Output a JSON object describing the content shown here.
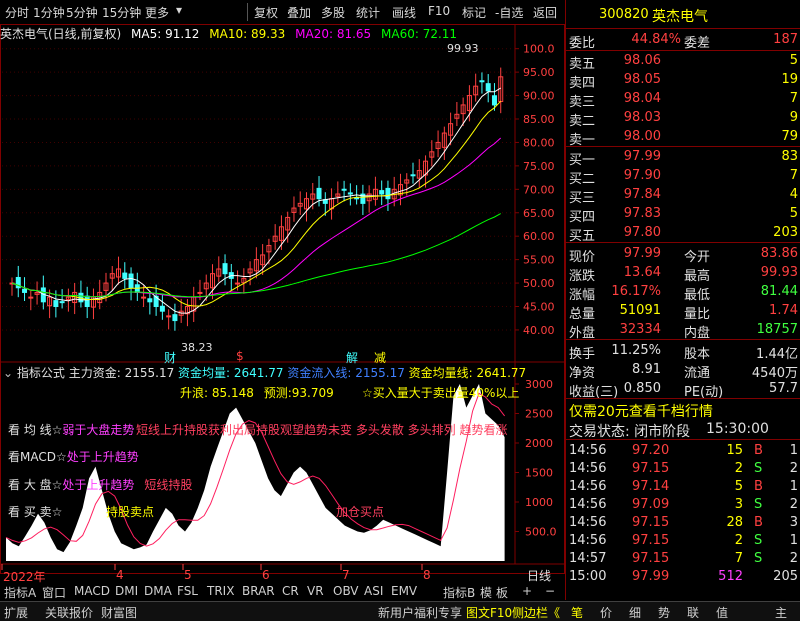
{
  "toolbar": {
    "left_items": [
      "分时",
      "1分钟",
      "5分钟",
      "15分钟",
      "更多"
    ],
    "right_items": [
      "复权",
      "叠加",
      "多股",
      "统计",
      "画线",
      "F10",
      "标记",
      "-自选",
      "返回"
    ]
  },
  "title_bar": {
    "name": "英杰电气(日线,前复权)",
    "ma5": "MA5: 91.12",
    "ma10": "MA10: 89.33",
    "ma20": "MA20: 81.65",
    "ma60": "MA60: 72.11"
  },
  "colors": {
    "ma5": "#ffffff",
    "ma10": "#ffff00",
    "ma20": "#ff00ff",
    "ma60": "#00ff00",
    "up": "#ff4040",
    "down": "#40ffff",
    "frame": "#800000"
  },
  "chart_data": [
    {
      "type": "candlestick",
      "title": "英杰电气(日线,前复权)",
      "ylim": [
        37,
        101
      ],
      "y_ticks": [
        "100.0",
        "95.00",
        "90.00",
        "85.00",
        "80.00",
        "75.00",
        "70.00",
        "65.00",
        "60.00",
        "55.00",
        "50.00",
        "45.00",
        "40.00"
      ],
      "annotations": {
        "high": "99.93",
        "low": "38.23"
      },
      "signals": [
        "财",
        "$",
        "解",
        "减"
      ],
      "close": [
        50,
        49,
        48,
        47,
        48,
        46,
        47,
        45,
        46,
        47,
        48,
        46,
        45,
        47,
        48,
        50,
        52,
        53,
        51,
        49,
        48,
        47,
        46,
        45,
        44,
        43,
        42,
        44,
        45,
        47,
        48,
        50,
        52,
        53,
        52,
        51,
        50,
        51,
        53,
        55,
        56,
        58,
        60,
        62,
        64,
        66,
        67,
        68,
        69,
        68,
        67,
        68,
        69,
        70,
        69,
        68,
        67,
        69,
        70,
        69,
        68,
        70,
        71,
        72,
        73,
        74,
        76,
        78,
        80,
        82,
        84,
        86,
        88,
        90,
        92,
        93,
        91,
        88,
        94
      ]
    },
    {
      "type": "area",
      "title": "指标公式 主力资金",
      "ylim": [
        0,
        3000
      ],
      "y_ticks": [
        "3000",
        "2500",
        "2000",
        "1500",
        "1000",
        "500.0"
      ],
      "values": [
        400,
        300,
        250,
        420,
        600,
        800,
        650,
        400,
        200,
        150,
        320,
        600,
        900,
        1400,
        1600,
        1200,
        800,
        500,
        300,
        250,
        200,
        230,
        280,
        500,
        700,
        900,
        800,
        600,
        500,
        650,
        900,
        1200,
        1600,
        1900,
        2200,
        2500,
        2600,
        2400,
        2200,
        2000,
        1700,
        1400,
        1200,
        1100,
        1300,
        1500,
        1600,
        1500,
        1300,
        1100,
        900,
        800,
        700,
        600,
        550,
        500,
        480,
        520,
        600,
        700,
        650,
        600,
        550,
        500,
        450,
        400,
        350,
        300,
        250,
        1500,
        2800,
        3000,
        2600,
        2800,
        3000,
        2500,
        2400,
        2300,
        2100
      ]
    }
  ],
  "indicator_header": {
    "label": "指标公式",
    "zhuli": "主力资金: 2155.17",
    "avg": "资金均量: 2641.77",
    "flow": "资金流入线: 2155.17",
    "avgline": "资金均量线: 2641.77",
    "shenglang": "升浪: 85.148",
    "yuce": "预测:93.709",
    "note": "☆买入量大于卖出量40%以上"
  },
  "indicator_labels": [
    {
      "text": "看 均 线☆",
      "tag": "弱于大盘走势",
      "extra": "短线上升持股获利出局持股观望趋势未变  多头发散 多头排列  趋势看涨"
    },
    {
      "text": "看MACD☆",
      "tag": "处于上升趋势",
      "extra": ""
    },
    {
      "text": "看 大 盘☆",
      "tag": "处于上升趋势",
      "extra": "短线持股"
    },
    {
      "text": "看 买 卖☆",
      "tag": "持股卖点",
      "extra": "加仓买点"
    }
  ],
  "x_axis": [
    "2022年",
    "4",
    "5",
    "6",
    "7",
    "8"
  ],
  "period_label": "日线",
  "bottom_tabs": [
    "指标A",
    "窗口",
    "MACD",
    "DMI",
    "DMA",
    "FSL",
    "TRIX",
    "BRAR",
    "CR",
    "VR",
    "OBV",
    "ASI",
    "EMV",
    "指标B",
    "模",
    "板"
  ],
  "status_bar": {
    "expand": "扩展",
    "related": "关联报价",
    "wealth": "财富图",
    "welfare": "新用户福利专享",
    "f10": "图文F10",
    "sidebar": "侧边栏《",
    "tools": [
      "笔",
      "价",
      "细",
      "势",
      "联",
      "值",
      "主"
    ]
  },
  "stock": {
    "code": "300820",
    "name": "英杰电气"
  },
  "order_book": {
    "weibi_label": "委比",
    "weibi": "44.84%",
    "weicha_label": "委差",
    "weicha": "187",
    "sells": [
      [
        "卖五",
        "98.06",
        "5"
      ],
      [
        "卖四",
        "98.05",
        "19"
      ],
      [
        "卖三",
        "98.04",
        "7"
      ],
      [
        "卖二",
        "98.03",
        "9"
      ],
      [
        "卖一",
        "98.00",
        "79"
      ]
    ],
    "buys": [
      [
        "买一",
        "97.99",
        "83"
      ],
      [
        "买二",
        "97.90",
        "7"
      ],
      [
        "买三",
        "97.84",
        "4"
      ],
      [
        "买四",
        "97.83",
        "5"
      ],
      [
        "买五",
        "97.80",
        "203"
      ]
    ]
  },
  "quote": {
    "rows": [
      [
        "现价",
        "97.99",
        "今开",
        "83.86"
      ],
      [
        "涨跌",
        "13.64",
        "最高",
        "99.93"
      ],
      [
        "涨幅",
        "16.17%",
        "最低",
        "81.44"
      ],
      [
        "总量",
        "51091",
        "量比",
        "1.74"
      ],
      [
        "外盘",
        "32334",
        "内盘",
        "18757"
      ],
      [
        "换手",
        "11.25%",
        "股本",
        "1.44亿"
      ],
      [
        "净资",
        "8.91",
        "流通",
        "4540万"
      ],
      [
        "收益(三)",
        "0.850",
        "PE(动)",
        "57.7"
      ]
    ]
  },
  "promo": "仅需20元查看千档行情",
  "trade_state": {
    "label": "交易状态: 闭市阶段",
    "time": "15:30:00"
  },
  "ticks": [
    [
      "14:56",
      "97.20",
      "15",
      "B",
      "1"
    ],
    [
      "14:56",
      "97.15",
      "2",
      "S",
      "2"
    ],
    [
      "14:56",
      "97.14",
      "5",
      "B",
      "1"
    ],
    [
      "14:56",
      "97.09",
      "3",
      "S",
      "2"
    ],
    [
      "14:56",
      "97.15",
      "28",
      "B",
      "3"
    ],
    [
      "14:56",
      "97.15",
      "2",
      "S",
      "1"
    ],
    [
      "14:57",
      "97.15",
      "7",
      "S",
      "2"
    ],
    [
      "15:00",
      "97.99",
      "512",
      "",
      "205"
    ]
  ]
}
